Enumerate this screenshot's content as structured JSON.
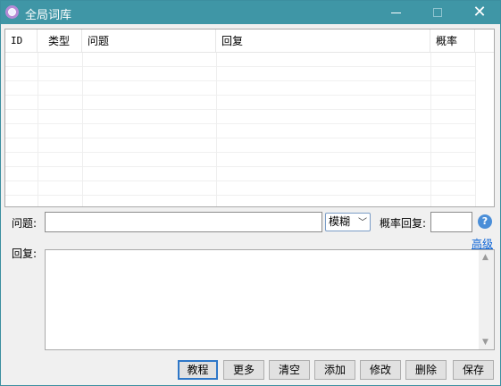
{
  "window": {
    "title": "全局词库",
    "minimize": "",
    "maximize": "",
    "close": "✕"
  },
  "table": {
    "columns": [
      "ID",
      "类型",
      "问题",
      "回复",
      "概率",
      ""
    ],
    "rows": []
  },
  "form": {
    "question_label": "问题:",
    "question_value": "",
    "match_mode": "模糊",
    "probability_label": "概率回复:",
    "probability_value": "",
    "help_glyph": "?",
    "advanced_link": "高级",
    "reply_label": "回复:",
    "reply_value": ""
  },
  "buttons": {
    "tutorial": "教程",
    "more": "更多",
    "clear": "清空",
    "add": "添加",
    "edit": "修改",
    "delete": "删除",
    "save": "保存"
  },
  "colors": {
    "titlebar": "#3f96a6",
    "accent_button_border": "#2f77c8",
    "link": "#0b63d6",
    "help_icon": "#4a8ed8"
  }
}
